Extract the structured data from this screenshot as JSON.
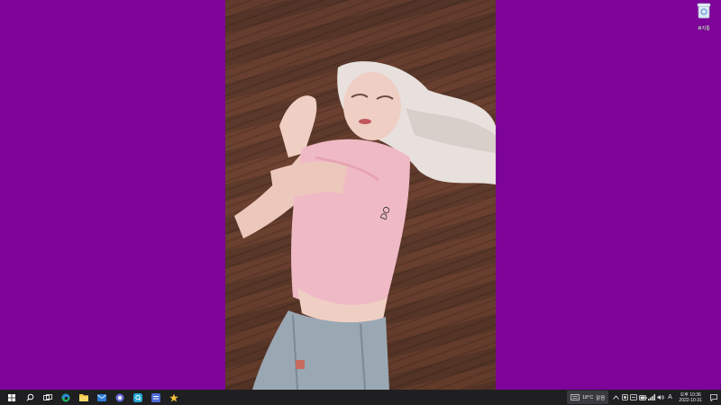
{
  "desktop": {
    "background_color": "#7e0399",
    "wallpaper": "photo-woman-lying-on-wooden-floor",
    "icons": [
      {
        "name": "recycle-bin-icon",
        "label": "휴지통"
      }
    ]
  },
  "taskbar": {
    "background_color": "#1f1f22",
    "pinned": [
      {
        "name": "start-icon"
      },
      {
        "name": "search-icon"
      },
      {
        "name": "task-view-icon"
      },
      {
        "name": "edge-icon"
      },
      {
        "name": "file-explorer-icon"
      },
      {
        "name": "mail-icon"
      },
      {
        "name": "chat-app-icon"
      },
      {
        "name": "search-app-icon"
      },
      {
        "name": "calendar-app-icon"
      },
      {
        "name": "star-app-icon"
      }
    ],
    "weather": {
      "temperature": "18°C",
      "condition": "맑음"
    },
    "tray": [
      {
        "name": "chevron-up-icon"
      },
      {
        "name": "tray-app-icon"
      },
      {
        "name": "tray-app-icon-2"
      },
      {
        "name": "battery-icon"
      },
      {
        "name": "wifi-icon"
      },
      {
        "name": "volume-icon"
      },
      {
        "name": "ime-icon",
        "label": "A"
      }
    ],
    "clock": {
      "time": "오후 10:36",
      "date": "2022-10-31"
    }
  }
}
